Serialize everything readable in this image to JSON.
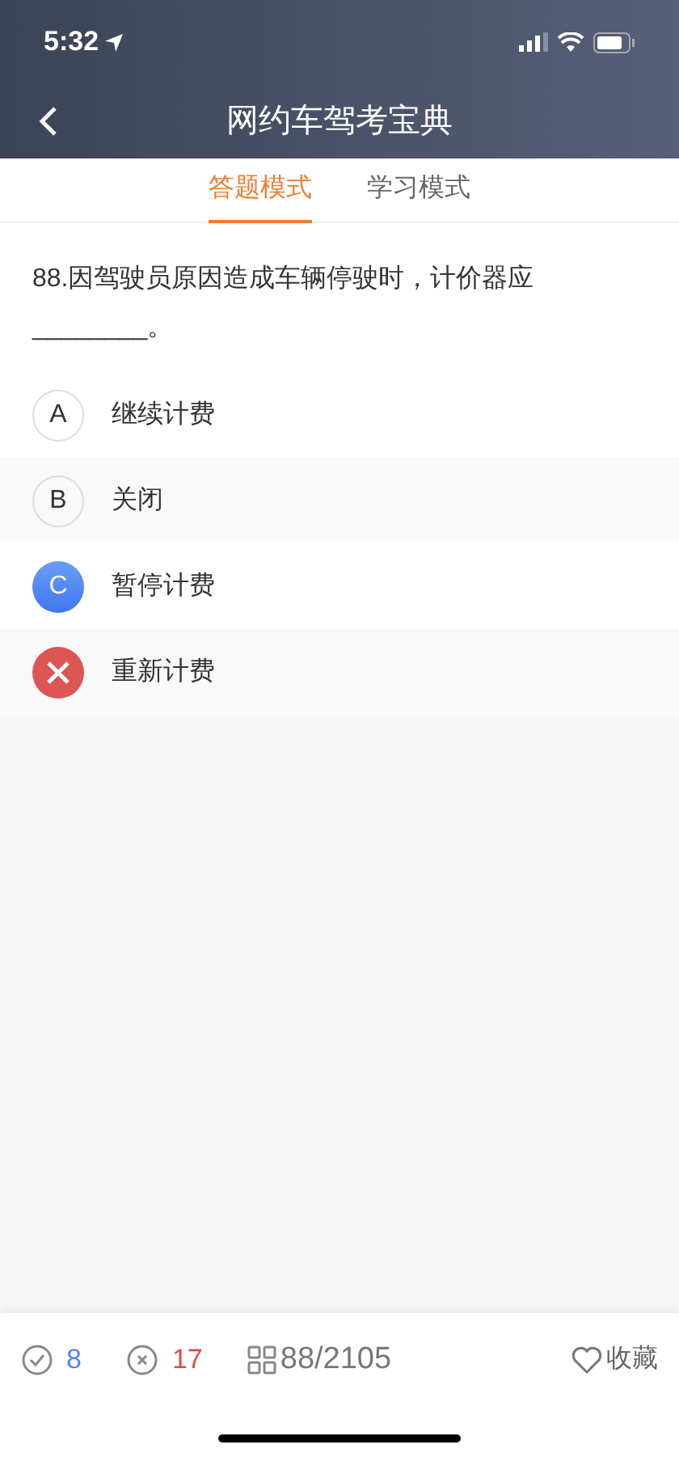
{
  "status_bar": {
    "time": "5:32"
  },
  "nav": {
    "title": "网约车驾考宝典"
  },
  "tabs": [
    {
      "label": "答题模式",
      "selected": true
    },
    {
      "label": "学习模式",
      "selected": false
    }
  ],
  "question": {
    "text": "88.因驾驶员原因造成车辆停驶时，计价器应________。"
  },
  "options": [
    {
      "letter": "A",
      "text": "继续计费",
      "kind": "normal"
    },
    {
      "letter": "B",
      "text": "关闭",
      "kind": "normal"
    },
    {
      "letter": "C",
      "text": "暂停计费",
      "kind": "correct"
    },
    {
      "text": "重新计费",
      "kind": "wrong"
    }
  ],
  "footer": {
    "right_count": "8",
    "wrong_count": "17",
    "progress": "88/2105",
    "favorite": "收藏"
  }
}
